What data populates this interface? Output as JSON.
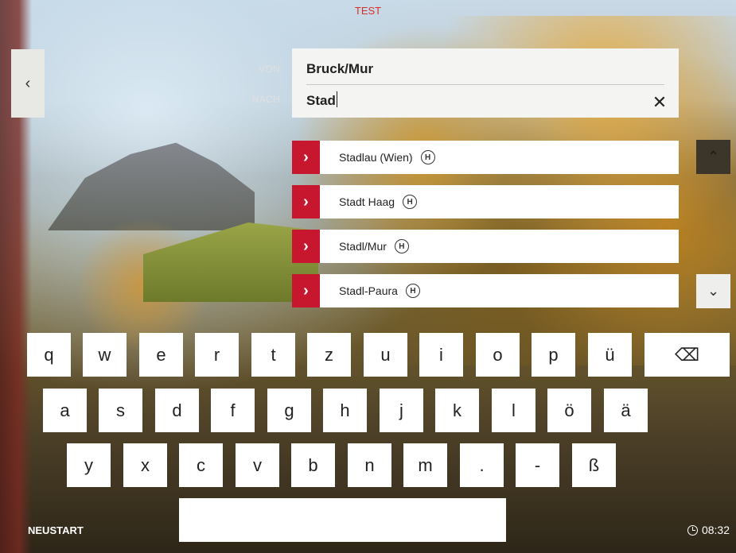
{
  "header": {
    "environment_label": "TEST"
  },
  "navigation": {
    "back_icon": "chevron-left-icon",
    "back_glyph": "‹"
  },
  "route": {
    "from_label": "VON",
    "from_value": "Bruck/Mur",
    "to_label": "NACH",
    "to_value": "Stad",
    "clear_glyph": "✕"
  },
  "suggestions": [
    {
      "name": "Stadlau (Wien)",
      "badge": "H"
    },
    {
      "name": "Stadt Haag",
      "badge": "H"
    },
    {
      "name": "Stadl/Mur",
      "badge": "H"
    },
    {
      "name": "Stadl-Paura",
      "badge": "H"
    }
  ],
  "suggestion_arrow": "›",
  "scroll": {
    "up_glyph": "⌃",
    "down_glyph": "⌄"
  },
  "keyboard": {
    "row1": [
      "q",
      "w",
      "e",
      "r",
      "t",
      "z",
      "u",
      "i",
      "o",
      "p",
      "ü"
    ],
    "backspace_glyph": "⌫",
    "row2": [
      "a",
      "s",
      "d",
      "f",
      "g",
      "h",
      "j",
      "k",
      "l",
      "ö",
      "ä"
    ],
    "row3": [
      "y",
      "x",
      "c",
      "v",
      "b",
      "n",
      "m",
      ".",
      "-",
      "ß"
    ]
  },
  "footer": {
    "restart_label": "NEUSTART",
    "time": "08:32"
  },
  "colors": {
    "accent": "#c6172e",
    "test_label": "#d6302b"
  }
}
